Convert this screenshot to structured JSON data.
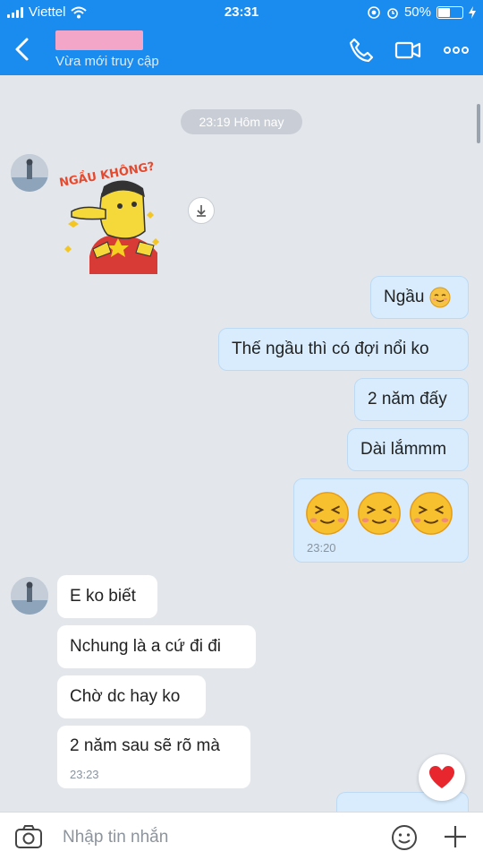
{
  "status": {
    "carrier": "Viettel",
    "time": "23:31",
    "battery": "50%",
    "battery_level": 0.5
  },
  "header": {
    "subtitle": "Vừa mới truy cập"
  },
  "chat": {
    "day_separator": "23:19 Hôm nay",
    "messages": [
      {
        "text": "Ngầu"
      },
      {
        "text": "Thế ngầu thì có đợi nổi ko"
      },
      {
        "text": "2 năm đấy"
      },
      {
        "text": "Dài lắmmm"
      },
      {
        "time": "23:20"
      },
      {
        "text": "E ko biết"
      },
      {
        "text": "Nchung là a cứ đi đi"
      },
      {
        "text": "Chờ dc hay ko"
      },
      {
        "text": "2 năm sau sẽ rõ mà",
        "time": "23:23"
      }
    ],
    "sticker_text": "NGẦU KHÔNG?"
  },
  "composer": {
    "placeholder": "Nhập tin nhắn"
  },
  "colors": {
    "brand": "#1a8cf0",
    "outgoing_bubble": "#d8ecfd",
    "incoming_bubble": "#ffffff",
    "background": "#e3e7ec"
  },
  "icons": [
    "signal-icon",
    "wifi-icon",
    "eye-icon",
    "alarm-icon",
    "battery-icon",
    "charging-icon",
    "back-icon",
    "phone-icon",
    "video-icon",
    "more-icon",
    "download-icon",
    "heart-icon",
    "camera-icon",
    "emoji-icon",
    "plus-icon"
  ]
}
